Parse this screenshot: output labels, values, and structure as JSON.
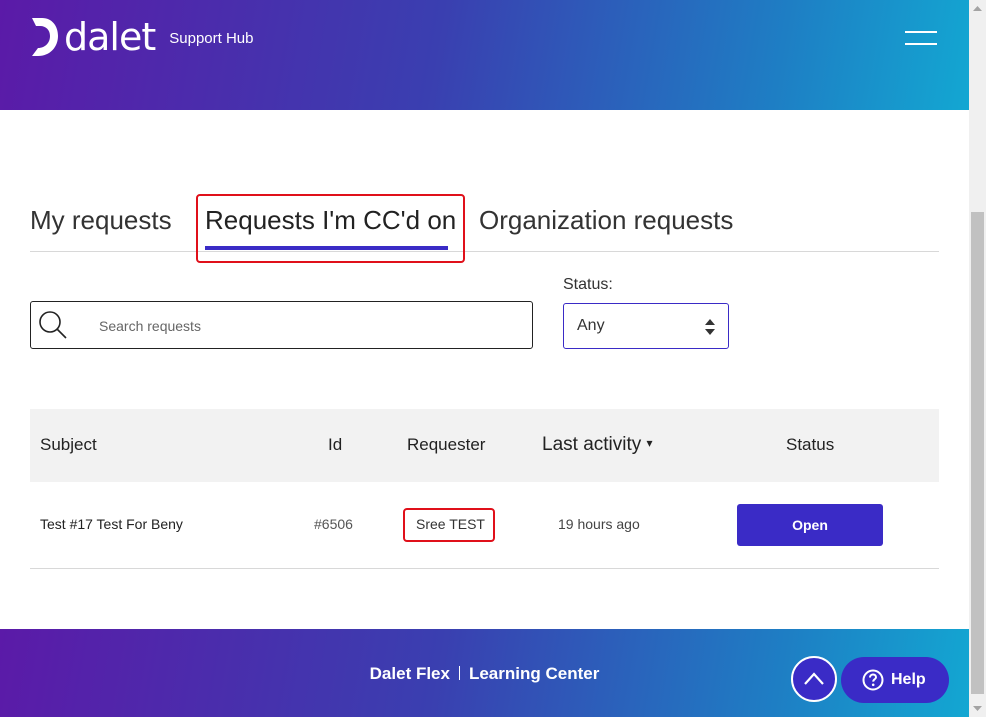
{
  "header": {
    "logo_text": "dalet",
    "subtitle": "Support Hub"
  },
  "tabs": [
    {
      "label": "My requests",
      "active": false
    },
    {
      "label": "Requests I'm CC'd on",
      "active": true
    },
    {
      "label": "Organization requests",
      "active": false
    }
  ],
  "search": {
    "placeholder": "Search requests",
    "value": ""
  },
  "status_filter": {
    "label": "Status:",
    "value": "Any"
  },
  "table": {
    "columns": [
      "Subject",
      "Id",
      "Requester",
      "Last activity",
      "Status"
    ],
    "sort_indicator": "▾",
    "rows": [
      {
        "subject": "Test #17 Test For Beny",
        "id": "#6506",
        "requester": "Sree TEST",
        "last_activity": "19 hours ago",
        "status": "Open"
      }
    ]
  },
  "footer": {
    "links": [
      "Dalet Flex",
      "Learning Center"
    ]
  },
  "help_button": {
    "label": "Help"
  },
  "colors": {
    "accent": "#3a2bc6",
    "header_gradient_start": "#5b1aa8",
    "header_gradient_end": "#13a7d2",
    "highlight": "#e0101a"
  },
  "icons": [
    "dalet-logo-icon",
    "menu-icon",
    "search-icon",
    "select-arrows-icon",
    "chevron-up-icon",
    "help-icon"
  ]
}
